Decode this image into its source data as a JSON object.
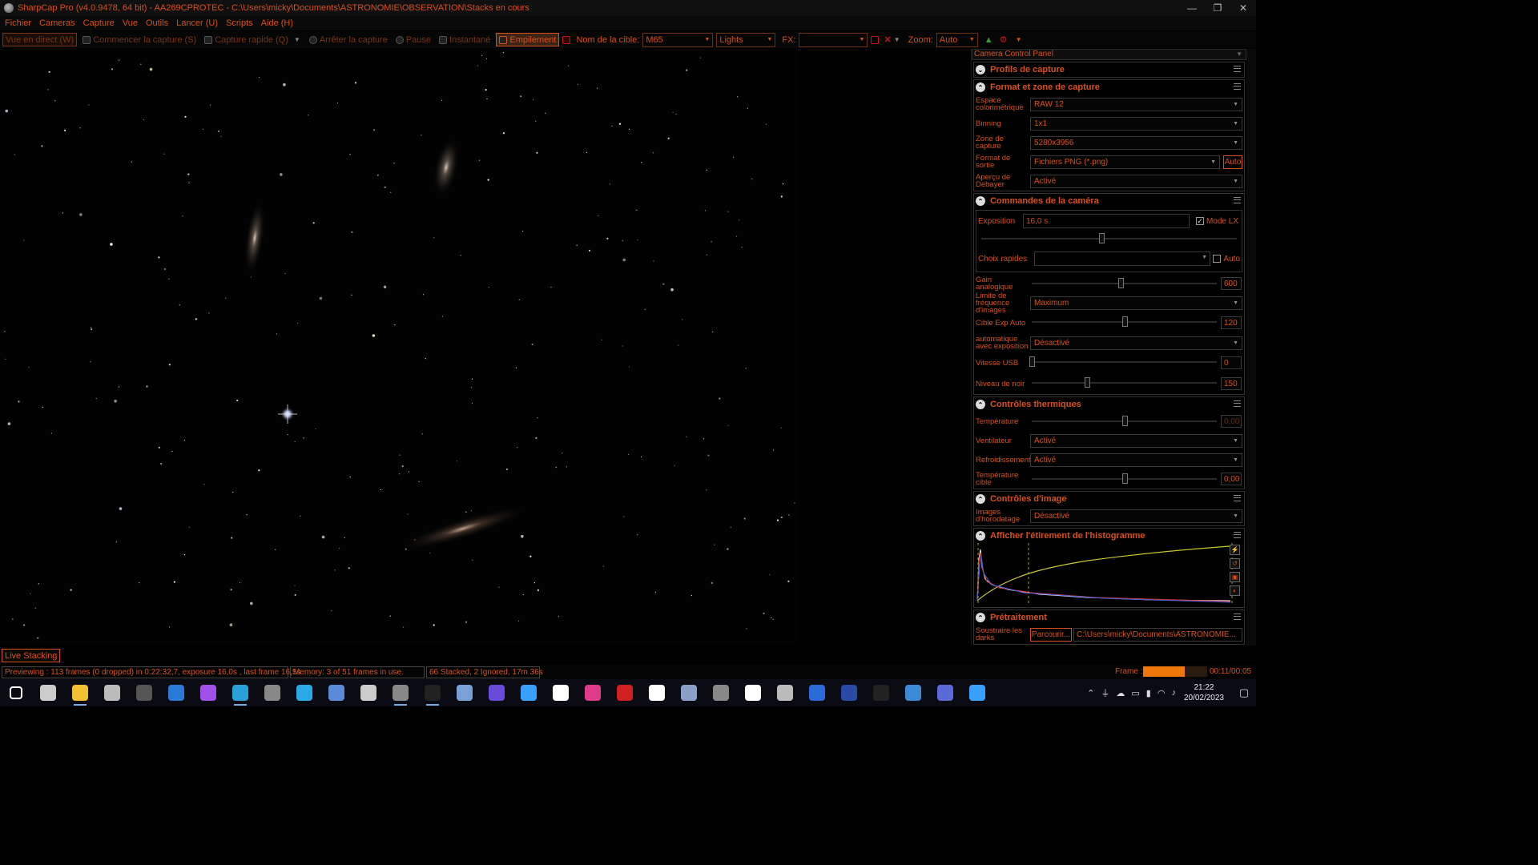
{
  "window": {
    "title": "SharpCap Pro (v4.0.9478, 64 bit) - AA269CPROTEC - C:\\Users\\micky\\Documents\\ASTRONOMIE\\OBSERVATION\\Stacks en cours",
    "minimize": "—",
    "maximize": "❐",
    "close": "✕"
  },
  "menu": [
    "Fichier",
    "Cameras",
    "Capture",
    "Vue",
    "Outils",
    "Lancer (U)",
    "Scripts",
    "Aide (H)"
  ],
  "toolbar": {
    "live_view": "Vue en direct (W)",
    "start_capture": "Commencer la capture (S)",
    "quick_capture": "Capture rapide (Q)",
    "stop_capture": "Arrêter la capture",
    "pause": "Pause",
    "snapshot": "Instantané",
    "stacking": "Empilement",
    "target_label": "Nom de la cible:",
    "target_value": "M65",
    "frame_type": "Lights",
    "fx_label": "FX:",
    "fx_value": "",
    "zoom_label": "Zoom:",
    "zoom_value": "Auto"
  },
  "panel": {
    "title": "Camera Control Panel",
    "sections": {
      "capture_profiles": "Profils de capture",
      "format": "Format et zone de capture",
      "camera_controls": "Commandes de la caméra",
      "thermal": "Contrôles thermiques",
      "image_controls": "Contrôles d'image",
      "histogram": "Afficher l'étirement de l'histogramme",
      "preprocessing": "Prétraitement"
    },
    "format": {
      "colorspace_label": "Espace colorimétrique",
      "colorspace_value": "RAW 12",
      "binning_label": "Binning",
      "binning_value": "1x1",
      "zone_label": "Zone de capture",
      "zone_value": "5280x3956",
      "output_label": "Format de sortie",
      "output_value": "Fichiers PNG (*.png)",
      "output_auto": "Auto",
      "debayer_label": "Aperçu de Debayer",
      "debayer_value": "Activé"
    },
    "camera": {
      "exposure_label": "Exposition",
      "exposure_value": "16,0 s",
      "lx_mode": "Mode LX",
      "lx_checked": true,
      "quick_label": "Choix rapides",
      "quick_value": "",
      "quick_auto": "Auto",
      "quick_auto_checked": false,
      "gain_label": "Gain analogique",
      "gain_value": "600",
      "gain_level": 0.48,
      "fps_label": "Limite de fréquence d'images",
      "fps_value": "Maximum",
      "target_exp_label": "Cible Exp Auto",
      "target_exp_value": "120",
      "target_exp_level": 0.5,
      "auto_exp_label": "automatique avec exposition",
      "auto_exp_value": "Désactivé",
      "usb_label": "Vitesse USB",
      "usb_value": "0",
      "usb_level": 0.0,
      "black_label": "Niveau de noir",
      "black_value": "150",
      "black_level": 0.3
    },
    "thermal": {
      "temp_label": "Température",
      "temp_value": "0,00",
      "temp_level": 0.5,
      "fan_label": "Ventilateur",
      "fan_value": "Activé",
      "cooling_label": "Refroidissement",
      "cooling_value": "Activé",
      "target_temp_label": "Température cible",
      "target_temp_value": "0,00",
      "target_temp_level": 0.5
    },
    "image": {
      "timestamp_label": "Images d'horodatage",
      "timestamp_value": "Désactivé"
    },
    "preprocessing": {
      "darks_label": "Soustraire les darks",
      "browse": "Parcourir...",
      "path": "C:\\Users\\micky\\Documents\\ASTRONOMIE..."
    }
  },
  "live_tab": "Live Stacking",
  "status": {
    "preview": "Previewing : 113 frames (0 dropped) in 0:22:32,7, exposure 16,0s , last frame 16,5s",
    "memory": "Memory: 3 of 51 frames in use.",
    "stacked": "66 Stacked, 2 Ignored, 17m 36s",
    "frame_label": "Frame :",
    "frame_progress": 0.65,
    "frame_time": "00:11/00:05"
  },
  "taskbar": {
    "time": "21:22",
    "date": "20/02/2023",
    "apps": [
      "windows-start",
      "task-view",
      "file-explorer",
      "settings",
      "notion",
      "mail",
      "messenger",
      "edge",
      "app-9",
      "app-10",
      "app-11",
      "app-12",
      "sharpcap",
      "pixinsight",
      "app-15",
      "stellarium",
      "app-17",
      "app-18",
      "app-19",
      "app-20",
      "app-21",
      "app-22",
      "app-23",
      "app-24",
      "app-25",
      "app-26",
      "app-27",
      "app-28",
      "app-29",
      "app-30",
      "app-31"
    ],
    "colors": {
      "accent": "#d94f1a",
      "taskbar_bg": "#0b0b14"
    }
  }
}
